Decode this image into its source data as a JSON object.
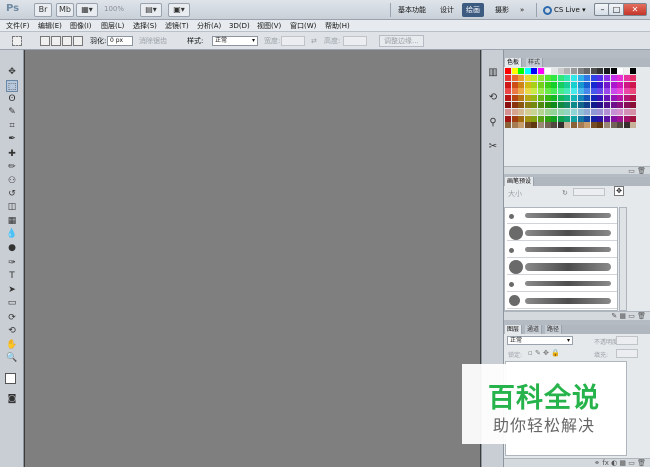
{
  "titlebar": {
    "logo": "Ps",
    "zoom": "100%",
    "workspaces": [
      "基本功能",
      "设计",
      "绘画",
      "摄影"
    ],
    "more": "»",
    "cs_live": "CS Live",
    "window": {
      "minimize": "–",
      "restore": "□",
      "close": "✕"
    }
  },
  "menu": [
    "文件(F)",
    "编辑(E)",
    "图像(I)",
    "图层(L)",
    "选择(S)",
    "滤镜(T)",
    "分析(A)",
    "3D(D)",
    "视图(V)",
    "窗口(W)",
    "帮助(H)"
  ],
  "options": {
    "feather_label": "羽化:",
    "feather_value": "0 px",
    "antialias": "消除锯齿",
    "style_label": "样式:",
    "style_value": "正常",
    "width_label": "宽度:",
    "height_label": "高度:",
    "refine_edge": "调整边缘..."
  },
  "tools": [
    "move-tool",
    "marquee-tool",
    "lasso-tool",
    "quick-select-tool",
    "crop-tool",
    "eyedropper-tool",
    "healing-tool",
    "brush-tool",
    "clone-stamp-tool",
    "history-brush-tool",
    "eraser-tool",
    "gradient-tool",
    "blur-tool",
    "dodge-tool",
    "pen-tool",
    "type-tool",
    "path-select-tool",
    "shape-tool",
    "3d-rotate-tool",
    "3d-orbit-tool",
    "hand-tool",
    "zoom-tool"
  ],
  "tool_glyphs": [
    "✥",
    "⬚",
    "ʘ",
    "✎",
    "⌗",
    "✒",
    "✚",
    "✏",
    "⚇",
    "↺",
    "◫",
    "▦",
    "💧",
    "●",
    "✑",
    "T",
    "➤",
    "▭",
    "⟳",
    "⟲",
    "✋",
    "🔍"
  ],
  "swatches_panel": {
    "tabs": [
      "色板",
      "样式"
    ]
  },
  "brush_panel": {
    "tab": "画笔预设",
    "size_label": "大小"
  },
  "layers_panel": {
    "tabs": [
      "图层",
      "通道",
      "路径"
    ],
    "blend_mode": "正常",
    "opacity_label": "不透明度:",
    "lock_label": "锁定:",
    "fill_label": "填充:"
  },
  "watermark": {
    "title": "百科全说",
    "subtitle": "助你轻松解决"
  },
  "colors": {
    "canvas": "#7f7f7f",
    "ui_bg": "#c9ced4",
    "active_workspace": "#3d5a80",
    "watermark_green": "#26b34b"
  }
}
